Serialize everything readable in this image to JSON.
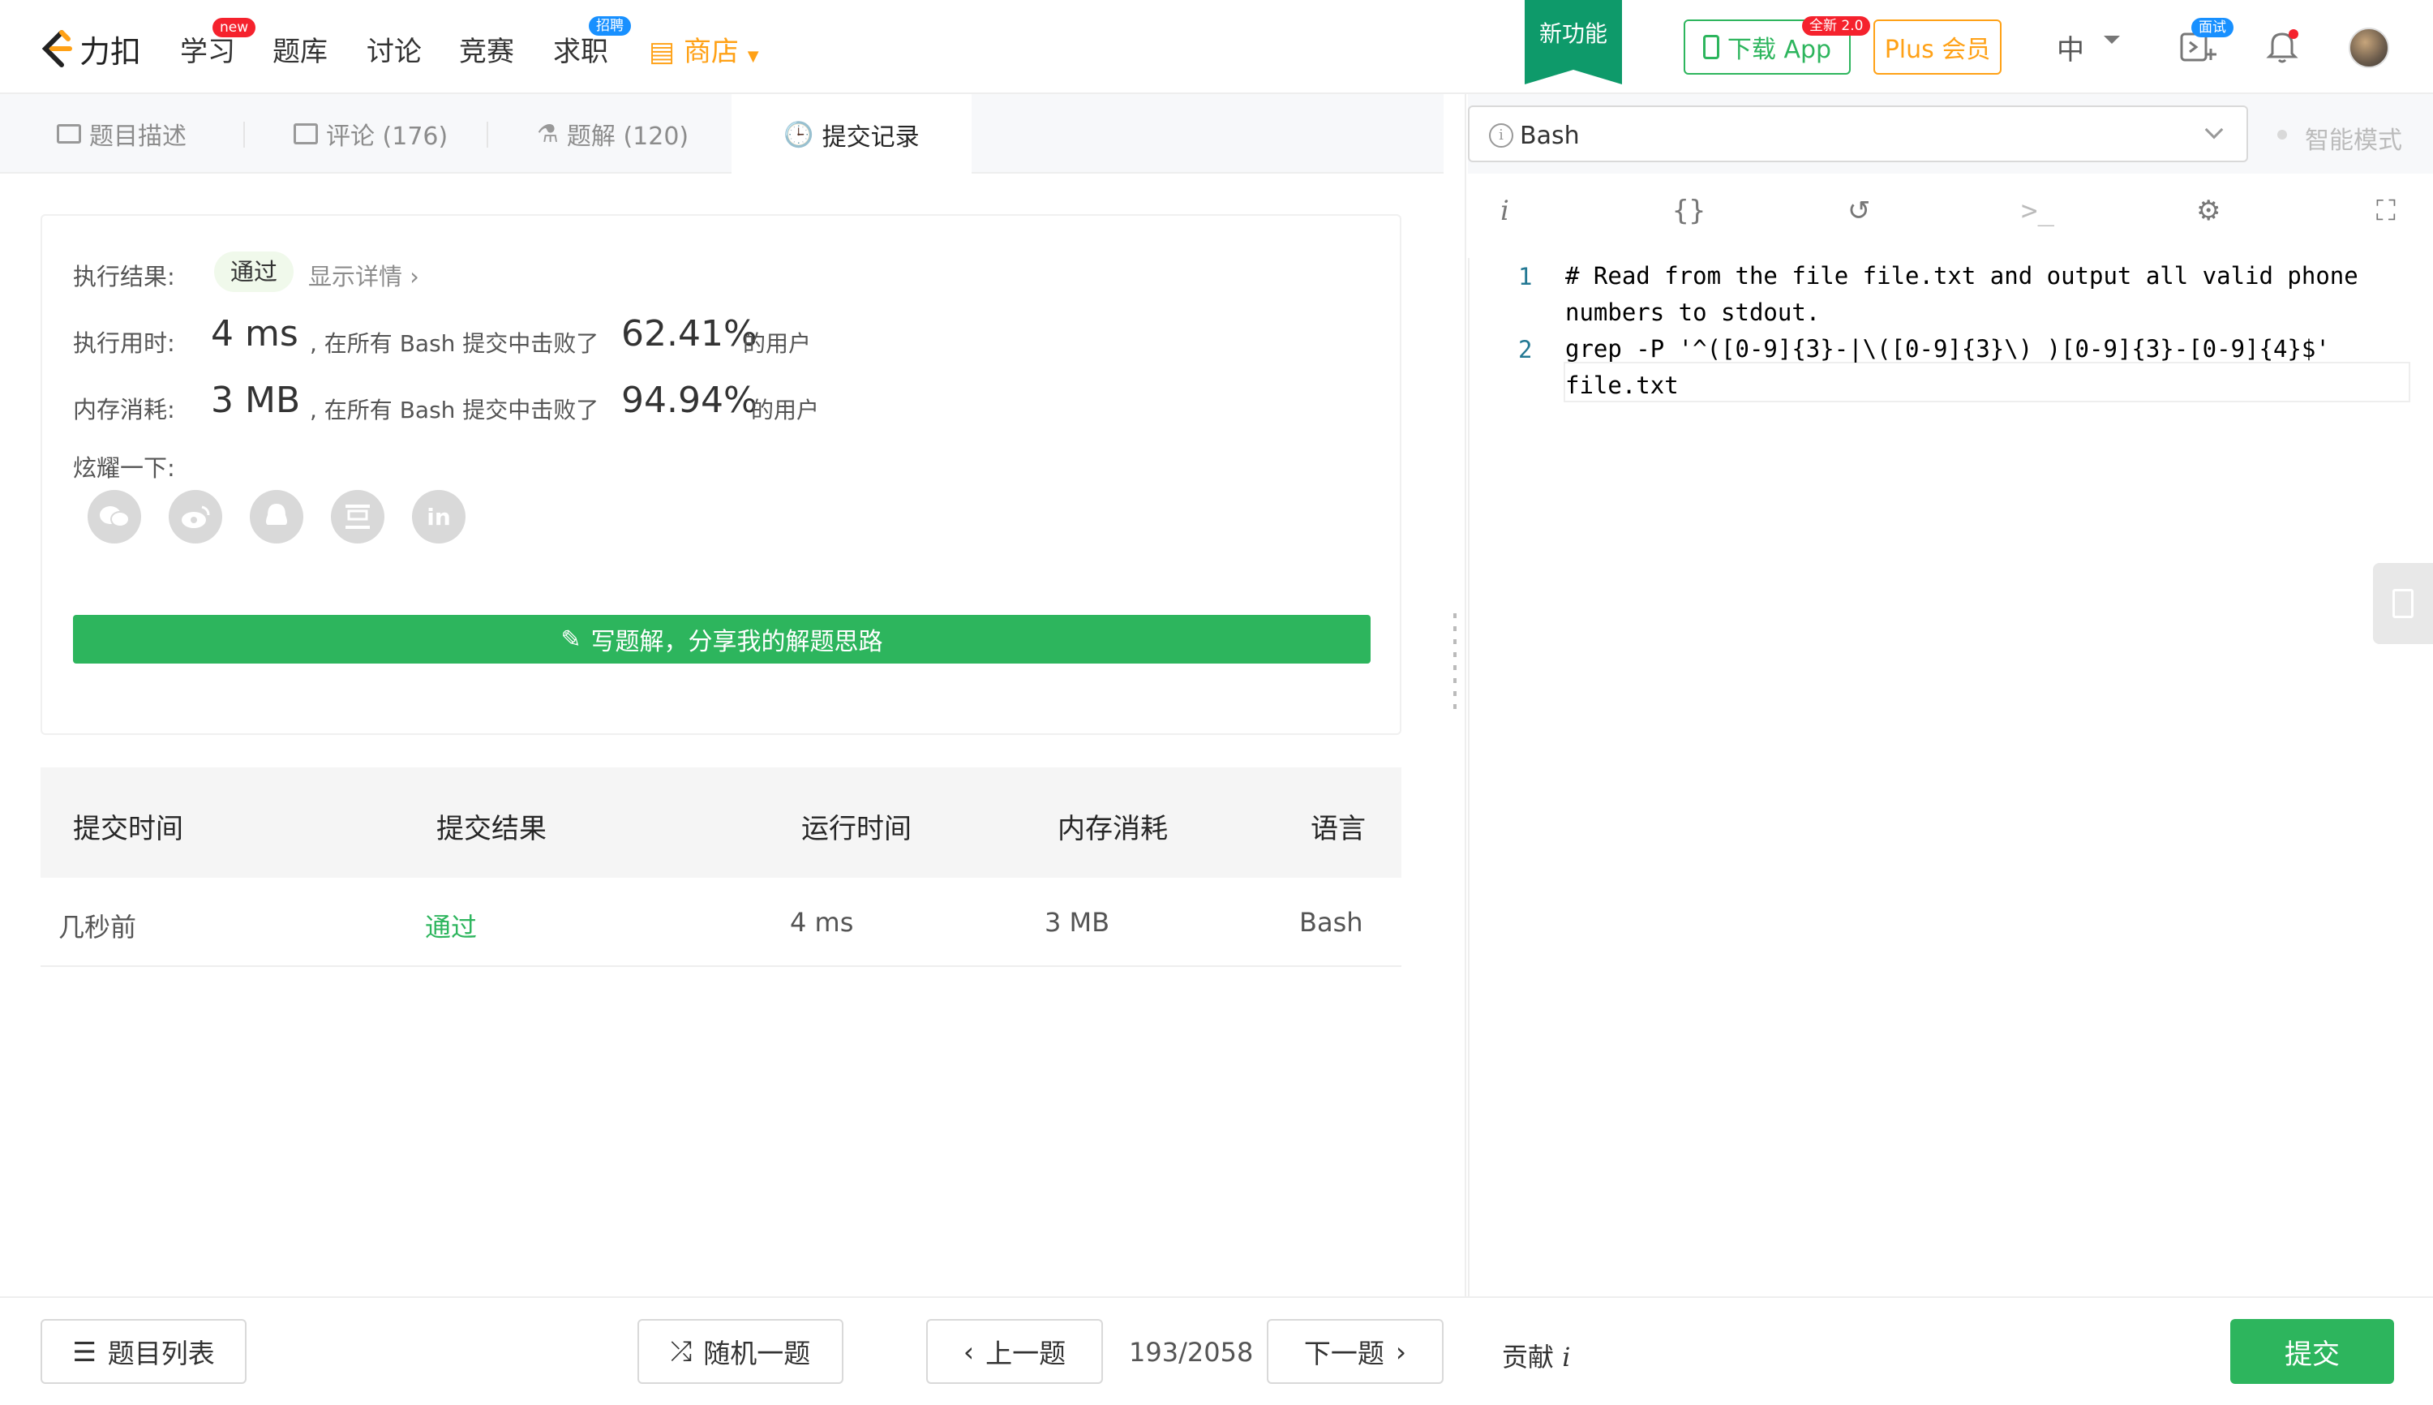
{
  "nav": {
    "logo_text": "力扣",
    "items": [
      "学习",
      "题库",
      "讨论",
      "竞赛",
      "求职"
    ],
    "badge_new": "new",
    "badge_jobs": "招聘",
    "store": "商店",
    "new_feature": "新功能",
    "download": "下载 App",
    "download_badge": "全新 2.0",
    "plus": "Plus 会员",
    "lang": "中",
    "interview_badge": "面试"
  },
  "tabs": {
    "description": "题目描述",
    "comments": "评论 (176)",
    "solutions": "题解 (120)",
    "submissions": "提交记录"
  },
  "result": {
    "label_result": "执行结果:",
    "status": "通过",
    "show_detail": "显示详情 ›",
    "label_time": "执行用时:",
    "time_value": "4 ms",
    "beat_text": ", 在所有 Bash 提交中击败了",
    "time_pct": "62.41%",
    "users_text": "的用户",
    "label_mem": "内存消耗:",
    "mem_value": "3 MB",
    "mem_pct": "94.94%",
    "label_share": "炫耀一下:",
    "write_solution": "写题解，分享我的解题思路"
  },
  "submissions": {
    "headers": [
      "提交时间",
      "提交结果",
      "运行时间",
      "内存消耗",
      "语言"
    ],
    "rows": [
      {
        "time": "几秒前",
        "result": "通过",
        "runtime": "4 ms",
        "memory": "3 MB",
        "lang": "Bash"
      }
    ]
  },
  "editor": {
    "language": "Bash",
    "smart_mode": "智能模式",
    "lines": [
      {
        "no": "1",
        "text": "# Read from the file file.txt and output all valid phone\nnumbers to stdout."
      },
      {
        "no": "2",
        "text": "grep -P '^([0-9]{3}-|\\([0-9]{3}\\) )[0-9]{3}-[0-9]{4}$'\nfile.txt"
      }
    ]
  },
  "footer": {
    "problem_list": "题目列表",
    "random": "随机一题",
    "prev": "上一题",
    "pager": "193/2058",
    "next": "下一题",
    "contribute": "贡献",
    "submit": "提交"
  },
  "colors": {
    "brand_green": "#2db55d",
    "accent_orange": "#ffa116",
    "feature_green": "#0e9a6a"
  }
}
